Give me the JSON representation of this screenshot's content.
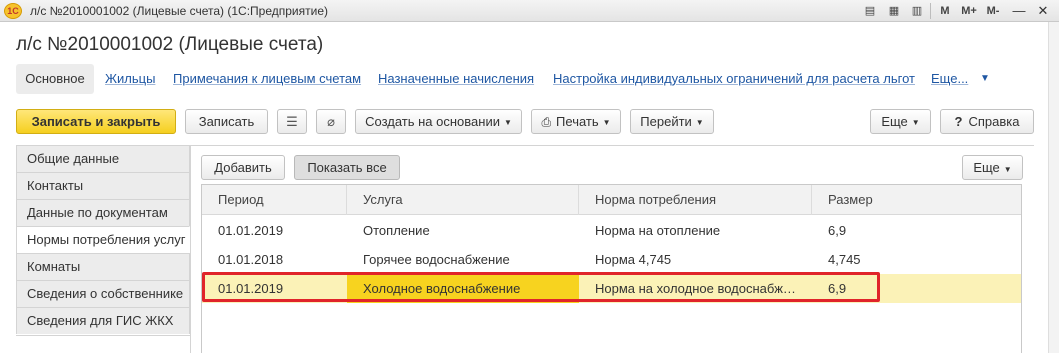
{
  "window": {
    "logo": "1С",
    "title": "л/с №2010001002 (Лицевые счета)  (1С:Предприятие)",
    "tools": {
      "m": "M",
      "m_plus": "M+",
      "m_minus": "M-"
    },
    "buttons": {
      "minimize": "—",
      "close": "✕"
    }
  },
  "form": {
    "title": "л/с №2010001002 (Лицевые счета)"
  },
  "tabs": [
    {
      "label": "Основное"
    },
    {
      "label": "Жильцы"
    },
    {
      "label": "Примечания к лицевым счетам"
    },
    {
      "label": "Назначенные начисления"
    },
    {
      "label": "Настройка индивидуальных ограничений для расчета льгот"
    },
    {
      "label": "Еще..."
    }
  ],
  "toolbar": {
    "save_close": "Записать и закрыть",
    "save": "Записать",
    "create_based": "Создать на основании",
    "print": "Печать",
    "goto": "Перейти",
    "more": "Еще",
    "help": "Справка",
    "help_mark": "?"
  },
  "sections": [
    {
      "label": "Общие данные"
    },
    {
      "label": "Контакты"
    },
    {
      "label": "Данные по документам"
    },
    {
      "label": "Нормы потребления услуг"
    },
    {
      "label": "Комнаты"
    },
    {
      "label": "Сведения о собственнике"
    },
    {
      "label": "Сведения для ГИС ЖКХ"
    }
  ],
  "subtoolbar": {
    "add": "Добавить",
    "show_all": "Показать все",
    "more": "Еще"
  },
  "table": {
    "columns": [
      "Период",
      "Услуга",
      "Норма потребления",
      "Размер"
    ],
    "rows": [
      [
        "01.01.2019",
        "Отопление",
        "Норма на отопление",
        "6,9"
      ],
      [
        "01.01.2018",
        "Горячее водоснабжение",
        "Норма 4,745",
        "4,745"
      ],
      [
        "01.01.2019",
        "Холодное водоснабжение",
        "Норма на холодное водоснабжение",
        "6,9"
      ]
    ],
    "selected_row": 2
  },
  "colors": {
    "accent_yellow": "#f5cf1f",
    "link_blue": "#1f57a3",
    "highlight_red": "#e0242a",
    "selected_row": "#fbf2b7"
  }
}
